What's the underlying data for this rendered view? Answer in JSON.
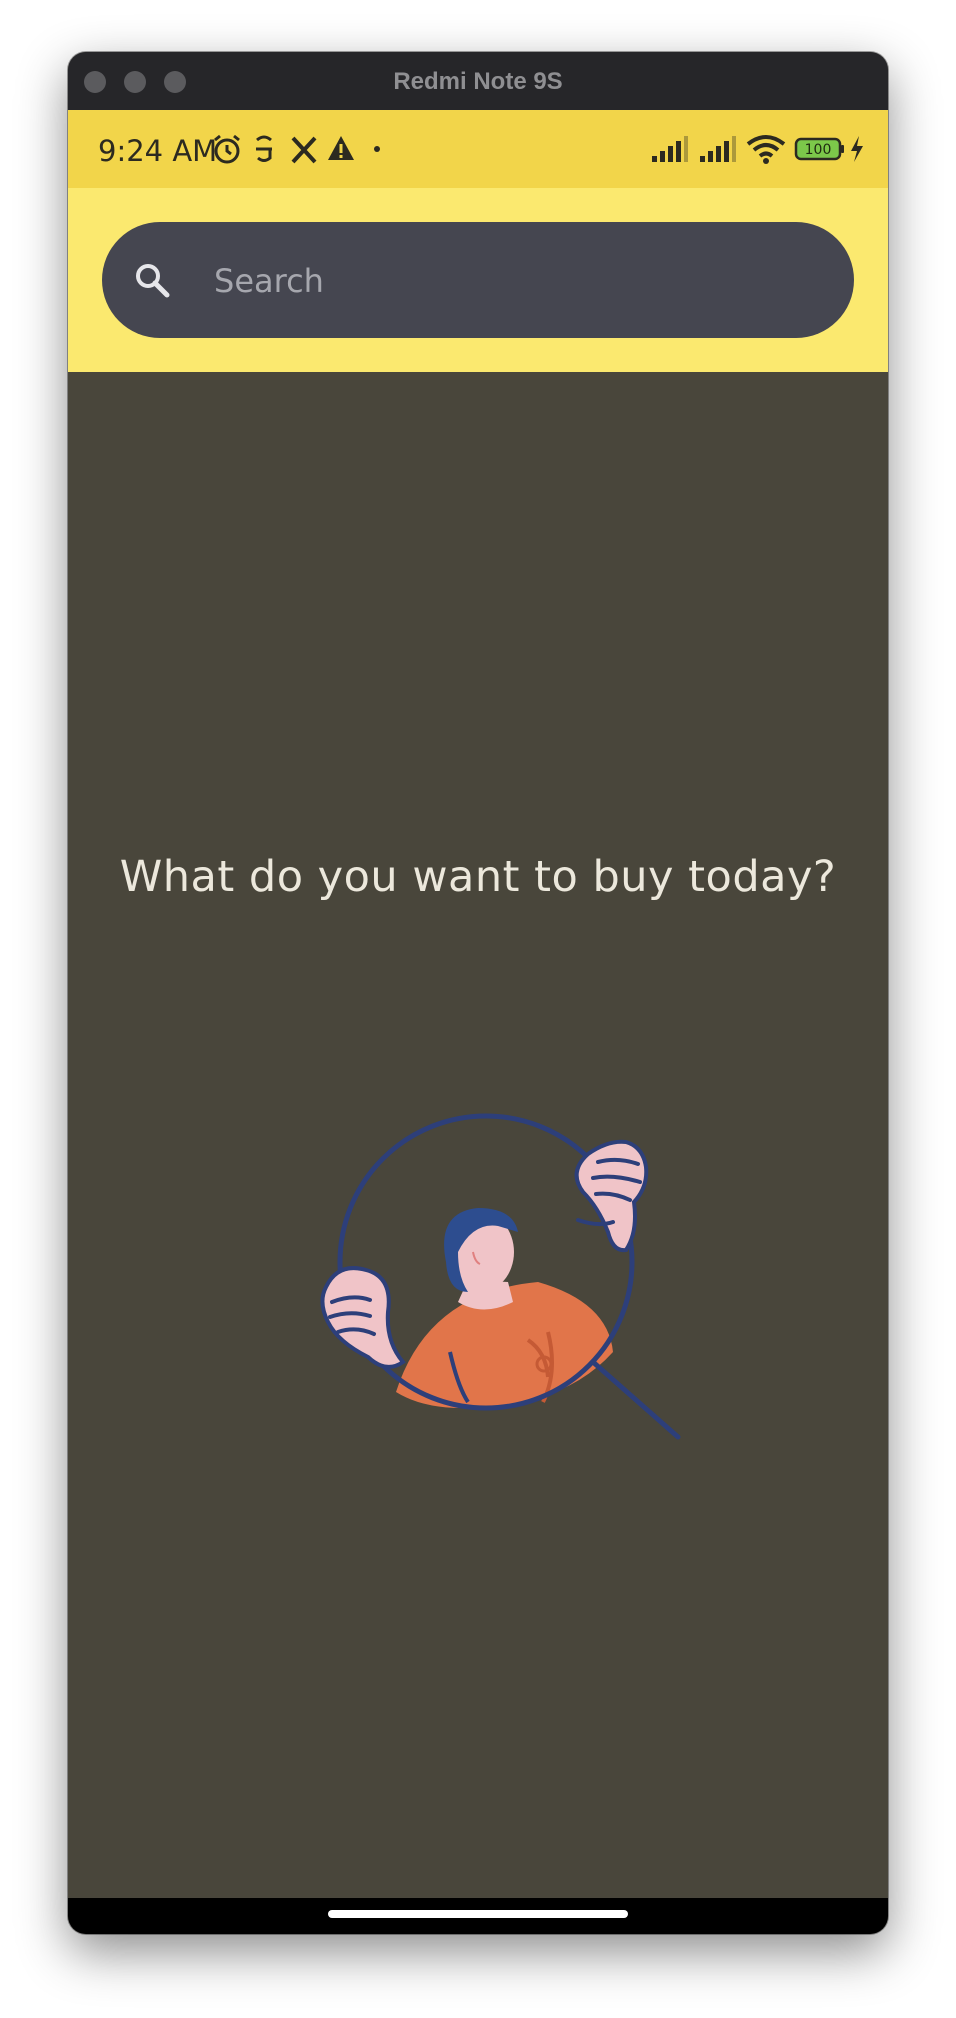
{
  "window": {
    "title": "Redmi Note 9S"
  },
  "status_bar": {
    "time": "9:24 AM",
    "battery_level": "100",
    "left_icons": [
      "alarm-icon",
      "notification-app-icon",
      "x-app-icon",
      "warning-icon",
      "more-notifications-dot"
    ],
    "right_icons": [
      "signal-sim1-icon",
      "signal-sim2-icon",
      "wifi-icon",
      "battery-icon",
      "charging-icon"
    ]
  },
  "search": {
    "placeholder": "Search"
  },
  "main": {
    "prompt": "What do you want to buy today?"
  },
  "colors": {
    "status_bar": "#f2d54a",
    "header": "#fbe96f",
    "search_field": "#454650",
    "background": "#49463b",
    "illustration_shirt": "#e1754a",
    "illustration_outline": "#2d3f7a",
    "illustration_skin": "#f0c4c8"
  }
}
